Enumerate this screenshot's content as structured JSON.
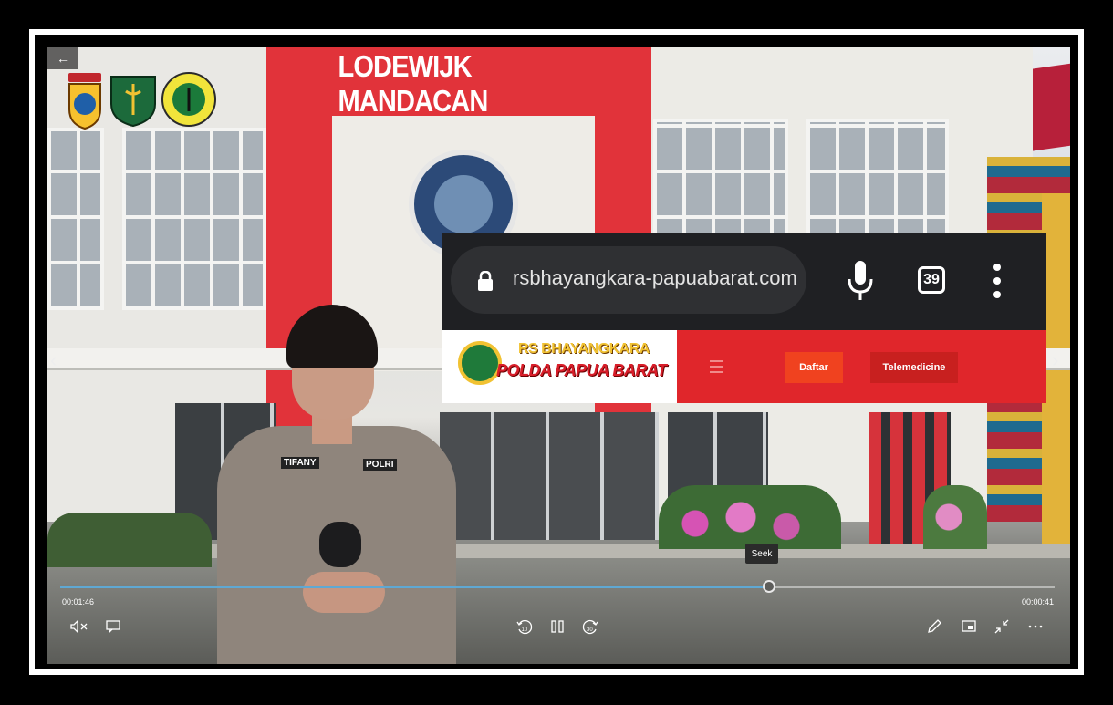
{
  "video": {
    "sign_text": "LODEWIJK MANDACAN",
    "person_tags": {
      "name": "TIFANY",
      "unit": "POLRI"
    }
  },
  "browser_overlay": {
    "url": "rsbhayangkara-papuabarat.com/t",
    "tab_count": "39",
    "site": {
      "brand_line1": "RS BHAYANGKARA",
      "brand_line2": "POLDA PAPUA BARAT",
      "buttons": {
        "daftar": "Daftar",
        "telemedicine": "Telemedicine"
      }
    }
  },
  "player": {
    "back_label": "←",
    "tooltip": "Seek",
    "time_elapsed": "00:01:46",
    "time_remaining": "00:00:41",
    "progress": 0.713,
    "icons": [
      "back-icon",
      "mute-icon",
      "captions-icon",
      "rewind-10-icon",
      "pause-icon",
      "forward-30-icon",
      "pen-icon",
      "miniplayer-icon",
      "exit-fullscreen-icon",
      "more-icon"
    ]
  }
}
